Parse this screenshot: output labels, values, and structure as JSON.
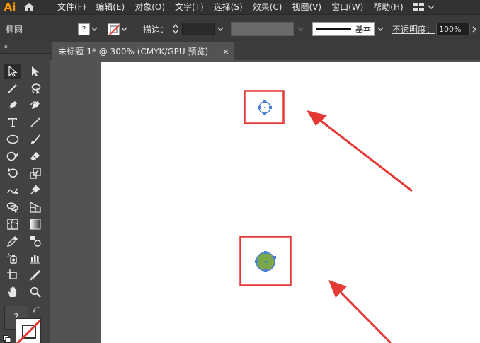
{
  "app": {
    "logo": "Ai"
  },
  "menu": {
    "items": [
      "文件(F)",
      "编辑(E)",
      "对象(O)",
      "文字(T)",
      "选择(S)",
      "效果(C)",
      "视图(V)",
      "窗口(W)",
      "帮助(H)"
    ]
  },
  "control": {
    "tool_name": "椭圆",
    "fill_swatch": "?",
    "stroke_label": "描边：",
    "brush_label": "基本",
    "opacity_label": "不透明度：",
    "opacity_value": "100%"
  },
  "document": {
    "tab_title": "未标题-1* @ 300% (CMYK/GPU 预览)",
    "close_glyph": "×"
  },
  "toolbox": {
    "collapse_glyph": "«",
    "fill_swatch": "?"
  },
  "colors": {
    "highlight_red": "#e53935",
    "selection_blue": "#4a7fd6",
    "circle_fill": "#7aa84a"
  }
}
